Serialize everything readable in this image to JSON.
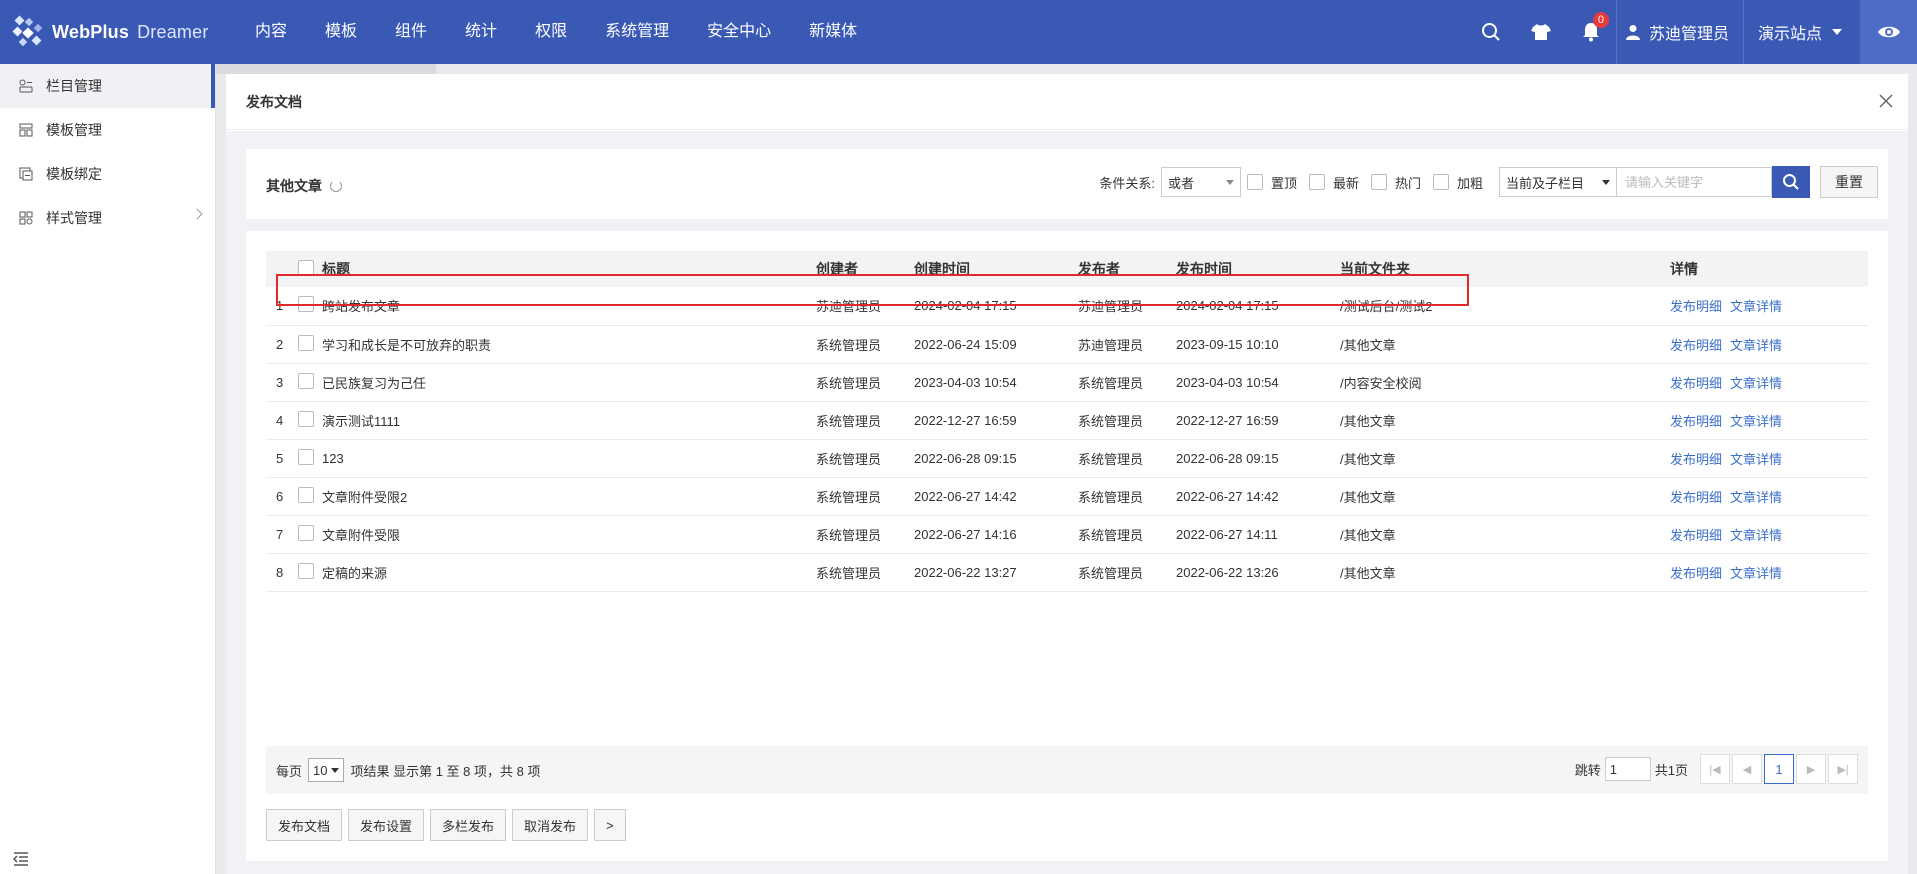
{
  "app": {
    "logo_text": "WebPlus",
    "logo_sub": "Dreamer"
  },
  "topnav": [
    "内容",
    "模板",
    "组件",
    "统计",
    "权限",
    "系统管理",
    "安全中心",
    "新媒体"
  ],
  "top_right": {
    "notifications_count": "0",
    "user_name": "苏迪管理员",
    "site_name": "演示站点"
  },
  "sidebar": {
    "items": [
      {
        "label": "栏目管理",
        "icon": "column-icon"
      },
      {
        "label": "模板管理",
        "icon": "template-icon"
      },
      {
        "label": "模板绑定",
        "icon": "bind-icon"
      },
      {
        "label": "样式管理",
        "icon": "style-icon"
      }
    ]
  },
  "dialog": {
    "title": "发布文档"
  },
  "filter": {
    "title": "其他文章",
    "condition_label": "条件关系:",
    "condition_value": "或者",
    "checks": [
      "置顶",
      "最新",
      "热门",
      "加粗"
    ],
    "scope_value": "当前及子栏目",
    "keyword_placeholder": "请输入关键字",
    "reset_label": "重置"
  },
  "table": {
    "headers": [
      "标题",
      "创建者",
      "创建时间",
      "发布者",
      "发布时间",
      "当前文件夹",
      "详情"
    ],
    "link1": "发布明细",
    "link2": "文章详情",
    "rows": [
      {
        "idx": "1",
        "title": "跨站发布文章",
        "creator": "苏迪管理员",
        "created": "2024-02-04 17:15",
        "publisher": "苏迪管理员",
        "published": "2024-02-04 17:15",
        "folder": "/测试后台/测试2"
      },
      {
        "idx": "2",
        "title": "学习和成长是不可放弃的职责",
        "creator": "系统管理员",
        "created": "2022-06-24 15:09",
        "publisher": "苏迪管理员",
        "published": "2023-09-15 10:10",
        "folder": "/其他文章"
      },
      {
        "idx": "3",
        "title": "已民族复习为己任",
        "creator": "系统管理员",
        "created": "2023-04-03 10:54",
        "publisher": "系统管理员",
        "published": "2023-04-03 10:54",
        "folder": "/内容安全校阅"
      },
      {
        "idx": "4",
        "title": "演示测试1111",
        "creator": "系统管理员",
        "created": "2022-12-27 16:59",
        "publisher": "系统管理员",
        "published": "2022-12-27 16:59",
        "folder": "/其他文章"
      },
      {
        "idx": "5",
        "title": "123",
        "creator": "系统管理员",
        "created": "2022-06-28 09:15",
        "publisher": "系统管理员",
        "published": "2022-06-28 09:15",
        "folder": "/其他文章"
      },
      {
        "idx": "6",
        "title": "文章附件受限2",
        "creator": "系统管理员",
        "created": "2022-06-27 14:42",
        "publisher": "系统管理员",
        "published": "2022-06-27 14:42",
        "folder": "/其他文章"
      },
      {
        "idx": "7",
        "title": "文章附件受限",
        "creator": "系统管理员",
        "created": "2022-06-27 14:16",
        "publisher": "系统管理员",
        "published": "2022-06-27 14:11",
        "folder": "/其他文章"
      },
      {
        "idx": "8",
        "title": "定稿的来源",
        "creator": "系统管理员",
        "created": "2022-06-22 13:27",
        "publisher": "系统管理员",
        "published": "2022-06-22 13:26",
        "folder": "/其他文章"
      }
    ]
  },
  "pager": {
    "per_page_label": "每页",
    "per_page_value": "10",
    "summary": "项结果 显示第 1 至 8 项，共 8 项",
    "jump_label": "跳转",
    "jump_value": "1",
    "total_pages": "共1页",
    "current_page": "1"
  },
  "actions": [
    "发布文档",
    "发布设置",
    "多栏发布",
    "取消发布",
    ">"
  ],
  "colors": {
    "primary": "#3a59b5",
    "link": "#3a6fc9",
    "highlight_border": "#e02a2a",
    "badge": "#e83a3a"
  }
}
